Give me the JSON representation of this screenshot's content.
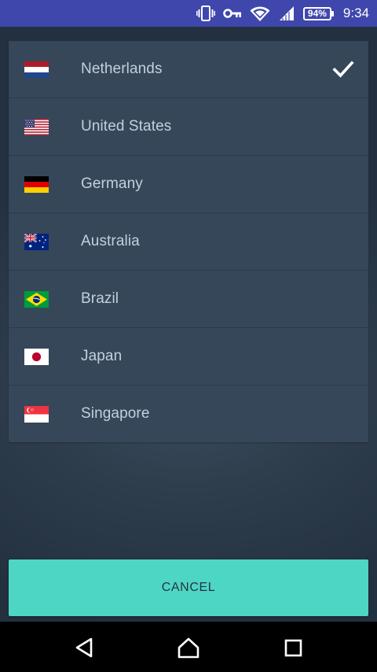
{
  "status_bar": {
    "icons": [
      "vibrate-icon",
      "vpn-key-icon",
      "wifi-icon",
      "signal-icon"
    ],
    "battery": "94%",
    "time": "9:34"
  },
  "countries": [
    {
      "name": "Netherlands",
      "flag": "netherlands-flag",
      "selected": true
    },
    {
      "name": "United States",
      "flag": "united-states-flag",
      "selected": false
    },
    {
      "name": "Germany",
      "flag": "germany-flag",
      "selected": false
    },
    {
      "name": "Australia",
      "flag": "australia-flag",
      "selected": false
    },
    {
      "name": "Brazil",
      "flag": "brazil-flag",
      "selected": false
    },
    {
      "name": "Japan",
      "flag": "japan-flag",
      "selected": false
    },
    {
      "name": "Singapore",
      "flag": "singapore-flag",
      "selected": false
    }
  ],
  "selected_icon": "checkmark-icon",
  "cancel_label": "CANCEL",
  "nav": {
    "icons": [
      "back-icon",
      "home-icon",
      "recent-apps-icon"
    ]
  },
  "colors": {
    "status_bar": "#3f47ac",
    "list_background": "#36475a",
    "text": "#c3d0dd",
    "accent": "#4ed6c4"
  }
}
